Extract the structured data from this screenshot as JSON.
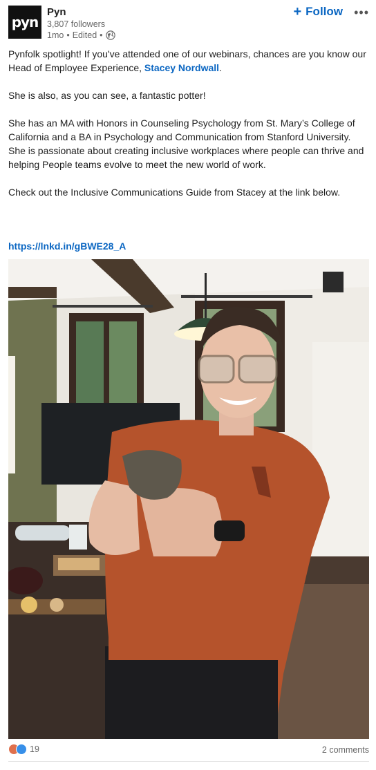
{
  "company": {
    "logo_text": "pyn",
    "name": "Pyn",
    "followers": "3,807 followers",
    "age": "1mo",
    "edited": "Edited",
    "visibility_icon": "globe-icon",
    "follow_label": "Follow",
    "more_label": "•••"
  },
  "post": {
    "p1_before": "Pynfolk spotlight! If you've attended one of our webinars, chances are you know our Head of Employee Experience, ",
    "mention": "Stacey Nordwall",
    "p1_after": ".",
    "p2": "She is also, as you can see, a fantastic potter!",
    "p3": "She has an MA with Honors in Counseling Psychology from St. Mary’s College of California and a BA in Psychology and Communication from Stanford University. She is passionate about creating inclusive workplaces where people can thrive and helping People teams evolve to meet the new world of work.",
    "p4": "Check out the Inclusive Communications Guide from Stacey at the link below.",
    "link": "https://lnkd.in/gBWE28_A"
  },
  "footer": {
    "reaction_count": "19",
    "comments": "2 comments"
  },
  "colors": {
    "accent": "#0a66c2",
    "shirt": "#b5532c"
  }
}
